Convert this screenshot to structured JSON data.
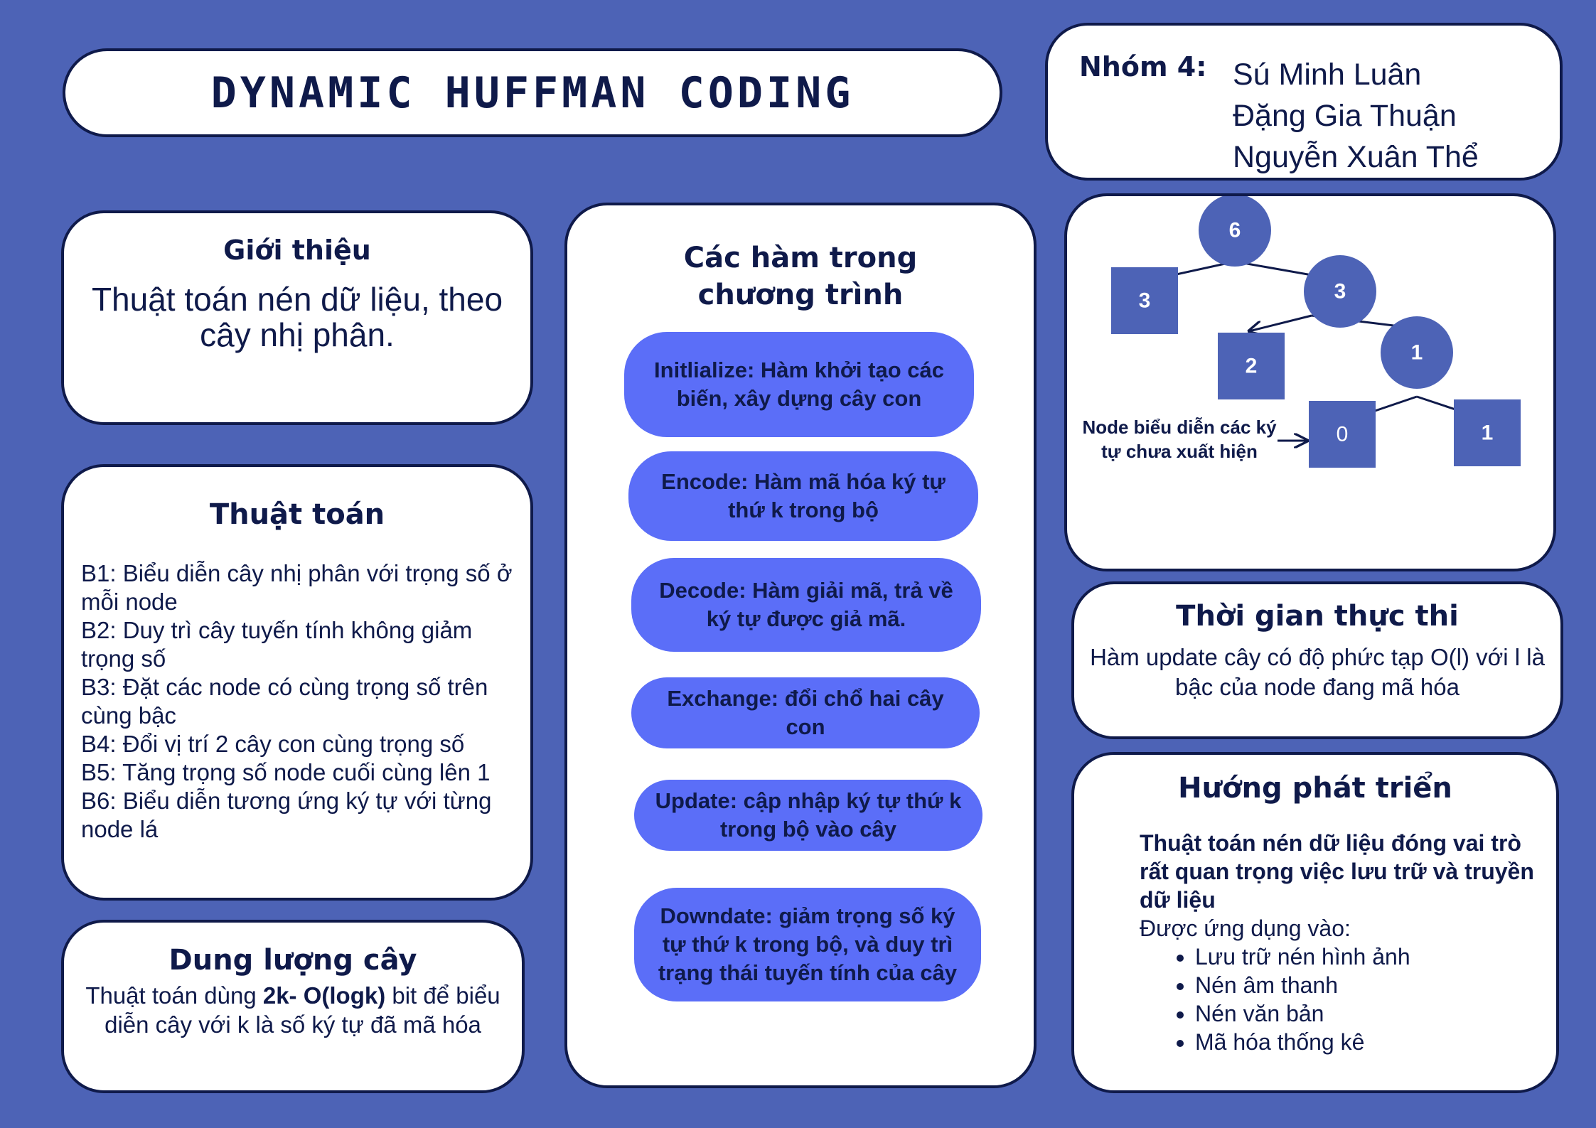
{
  "title": "DYNAMIC HUFFMAN CODING",
  "group": {
    "label": "Nhóm 4:",
    "members": [
      "Sú Minh Luân",
      "Đặng Gia Thuận",
      "Nguyễn Xuân Thể"
    ]
  },
  "intro": {
    "heading": "Giới thiệu",
    "text": "Thuật toán nén dữ liệu, theo cây nhị phân."
  },
  "algorithm": {
    "heading": "Thuật toán",
    "steps": [
      "B1: Biểu diễn cây nhị phân với trọng số ở mỗi node",
      "B2: Duy trì cây tuyến tính không giảm trọng số",
      "B3: Đặt các node có cùng trọng số trên cùng bậc",
      "B4: Đổi vị trí 2 cây con cùng trọng số",
      "B5: Tăng trọng số node cuối cùng lên 1",
      "B6: Biểu diễn tương ứng ký tự với từng node lá"
    ]
  },
  "capacity": {
    "heading": "Dung lượng cây",
    "text_before": "Thuật toán dùng ",
    "text_bold": "2k- O(logk)",
    "text_after": " bit để biểu diễn cây với k là số ký tự đã mã hóa"
  },
  "functions": {
    "heading": "Các hàm trong chương trình",
    "items": [
      "Initlialize: Hàm khởi tạo các biến, xây dựng cây con",
      "Encode: Hàm mã hóa ký tự thứ k trong bộ",
      "Decode: Hàm giải mã, trả về ký tự được giả mã.",
      "Exchange: đổi chổ hai cây con",
      "Update: cập nhập ký tự thứ k trong bộ vào cây",
      "Downdate: giảm trọng số ký tự thứ k trong bộ, và duy trì trạng thái tuyến tính của cây"
    ]
  },
  "tree": {
    "nodes": [
      "6",
      "3",
      "3",
      "2",
      "1",
      "0",
      "1"
    ],
    "annotation": [
      "Node  biểu diễn các ký",
      "tự chưa xuất hiện"
    ],
    "colors": {
      "node": "#4d63b6",
      "text": "#ffffff",
      "edge": "#0f1a4a"
    }
  },
  "runtime": {
    "heading": "Thời gian thực thi",
    "text": "Hàm update cây có độ phức tạp O(l) với l là bậc của node đang mã hóa"
  },
  "development": {
    "heading": "Hướng phát triển",
    "bold_text": "Thuật toán nén dữ liệu đóng vai trò rất quan trọng việc lưu trữ và truyền dữ liệu",
    "intro": "Được ứng dụng vào:",
    "items": [
      "Lưu trữ nén hình ảnh",
      "Nén âm thanh",
      "Nén văn bản",
      "Mã hóa thống kê"
    ]
  },
  "colors": {
    "background": "#4d63b6",
    "card": "#ffffff",
    "border": "#0f1a4a",
    "pill": "#5b6ef8"
  }
}
